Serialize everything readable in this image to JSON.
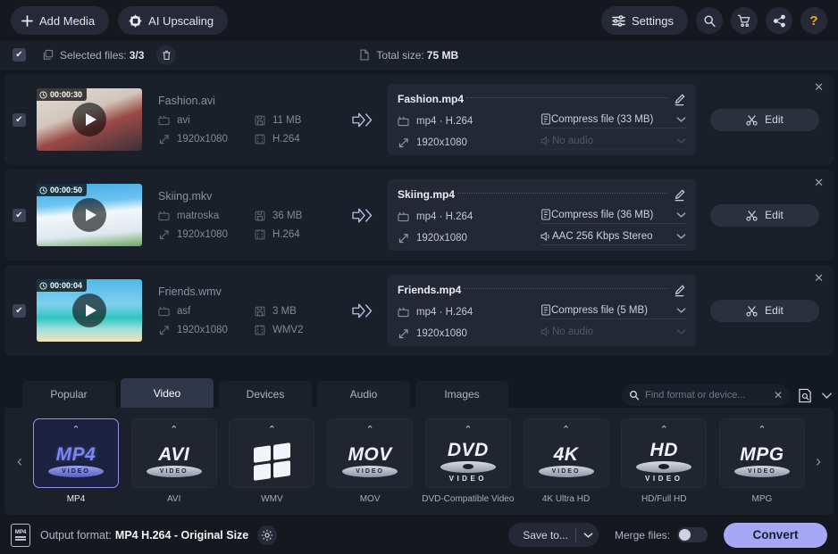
{
  "toolbar": {
    "add_media_label": "Add Media",
    "add_media_icon": "plus-icon",
    "ai_upscaling_label": "AI Upscaling",
    "ai_upscaling_icon": "chip-icon",
    "settings_label": "Settings",
    "settings_icon": "sliders-icon",
    "search_icon": "search-icon",
    "cart_icon": "cart-icon",
    "share_icon": "share-icon",
    "help_icon": "question-mark-icon",
    "help_label": "?",
    "help_color": "#f0a830"
  },
  "selection_bar": {
    "checkbox_icon": "checkmark-icon",
    "checkbox_glyph": "✔",
    "files_icon": "copy-files-icon",
    "selected_label": "Selected files:",
    "selected_count": "3/3",
    "trash_icon": "trash-icon",
    "size_icon": "document-icon",
    "total_size_label": "Total size:",
    "total_size_value": "75 MB"
  },
  "files": [
    {
      "checkbox_glyph": "✔",
      "duration": "00:00:30",
      "clock_icon": "clock-icon",
      "play_icon": "play-icon",
      "thumb_colors": [
        "#d9cfc6",
        "#8a3a3c",
        "#2a2a30"
      ],
      "source_name": "Fashion.avi",
      "container_icon": "film-icon",
      "container": "avi",
      "size_icon": "floppy-icon",
      "size": "11 MB",
      "resolution_icon": "resize-icon",
      "resolution": "1920x1080",
      "codec_icon": "filmstrip-icon",
      "codec": "H.264",
      "convert_arrow_icon": "double-arrow-right-icon",
      "output_name": "Fashion.mp4",
      "edit_name_icon": "pencil-icon",
      "out_format_icon": "film-icon",
      "out_format": "mp4 · H.264",
      "out_resolution_icon": "resize-icon",
      "out_resolution": "1920x1080",
      "compress_icon": "file-size-icon",
      "compress_value": "Compress file (33 MB)",
      "audio_icon": "speaker-icon",
      "audio_value": "No audio",
      "audio_disabled": true,
      "edit_button_label": "Edit",
      "edit_button_icon": "scissors-icon",
      "close_icon": "close-icon",
      "close_glyph": "✕"
    },
    {
      "checkbox_glyph": "✔",
      "duration": "00:00:50",
      "clock_icon": "clock-icon",
      "play_icon": "play-icon",
      "thumb_colors": [
        "#3fa9e8",
        "#eef4f8",
        "#e8d33c"
      ],
      "source_name": "Skiing.mkv",
      "container_icon": "film-icon",
      "container": "matroska",
      "size_icon": "floppy-icon",
      "size": "36 MB",
      "resolution_icon": "resize-icon",
      "resolution": "1920x1080",
      "codec_icon": "filmstrip-icon",
      "codec": "H.264",
      "convert_arrow_icon": "double-arrow-right-icon",
      "output_name": "Skiing.mp4",
      "edit_name_icon": "pencil-icon",
      "out_format_icon": "film-icon",
      "out_format": "mp4 · H.264",
      "out_resolution_icon": "resize-icon",
      "out_resolution": "1920x1080",
      "compress_icon": "file-size-icon",
      "compress_value": "Compress file (36 MB)",
      "audio_icon": "speaker-icon",
      "audio_value": "AAC 256 Kbps Stereo",
      "audio_disabled": false,
      "edit_button_label": "Edit",
      "edit_button_icon": "scissors-icon",
      "close_icon": "close-icon",
      "close_glyph": "✕"
    },
    {
      "checkbox_glyph": "✔",
      "duration": "00:00:04",
      "clock_icon": "clock-icon",
      "play_icon": "play-icon",
      "thumb_colors": [
        "#4fb8e8",
        "#2fc6c0",
        "#f2e2b8"
      ],
      "source_name": "Friends.wmv",
      "container_icon": "film-icon",
      "container": "asf",
      "size_icon": "floppy-icon",
      "size": "3 MB",
      "resolution_icon": "resize-icon",
      "resolution": "1920x1080",
      "codec_icon": "filmstrip-icon",
      "codec": "WMV2",
      "convert_arrow_icon": "double-arrow-right-icon",
      "output_name": "Friends.mp4",
      "edit_name_icon": "pencil-icon",
      "out_format_icon": "film-icon",
      "out_format": "mp4 · H.264",
      "out_resolution_icon": "resize-icon",
      "out_resolution": "1920x1080",
      "compress_icon": "file-size-icon",
      "compress_value": "Compress file (5 MB)",
      "audio_icon": "speaker-icon",
      "audio_value": "No audio",
      "audio_disabled": true,
      "edit_button_label": "Edit",
      "edit_button_icon": "scissors-icon",
      "close_icon": "close-icon",
      "close_glyph": "✕"
    }
  ],
  "tabs": [
    {
      "label": "Popular",
      "active": false
    },
    {
      "label": "Video",
      "active": true
    },
    {
      "label": "Devices",
      "active": false
    },
    {
      "label": "Audio",
      "active": false
    },
    {
      "label": "Images",
      "active": false
    }
  ],
  "search": {
    "icon": "search-icon",
    "placeholder": "Find format or device...",
    "value": "",
    "clear_icon": "close-icon",
    "clear_glyph": "✕",
    "browse_icon": "saved-search-icon",
    "expand_icon": "chevron-down-icon"
  },
  "format_strip": {
    "prev_icon": "chevron-left-icon",
    "prev_glyph": "‹",
    "next_icon": "chevron-right-icon",
    "next_glyph": "›",
    "cards": [
      {
        "id": "mp4",
        "logo_text": "MP4",
        "sub_text": "VIDEO",
        "caption": "MP4",
        "selected": true,
        "style": "ellipse"
      },
      {
        "id": "avi",
        "logo_text": "AVI",
        "sub_text": "VIDEO",
        "caption": "AVI",
        "selected": false,
        "style": "ellipse"
      },
      {
        "id": "wmv",
        "logo_text": "",
        "sub_text": "",
        "caption": "WMV",
        "selected": false,
        "style": "windows"
      },
      {
        "id": "mov",
        "logo_text": "MOV",
        "sub_text": "VIDEO",
        "caption": "MOV",
        "selected": false,
        "style": "ellipse"
      },
      {
        "id": "dvd",
        "logo_text": "DVD",
        "sub_text": "VIDEO",
        "caption": "DVD-Compatible Video",
        "selected": false,
        "style": "disc"
      },
      {
        "id": "4k",
        "logo_text": "4K",
        "sub_text": "VIDEO",
        "caption": "4K Ultra HD",
        "selected": false,
        "style": "ellipse"
      },
      {
        "id": "hd",
        "logo_text": "HD",
        "sub_text": "VIDEO",
        "caption": "HD/Full HD",
        "selected": false,
        "style": "disc"
      },
      {
        "id": "mpg",
        "logo_text": "MPG",
        "sub_text": "VIDEO",
        "caption": "MPG",
        "selected": false,
        "style": "ellipse"
      }
    ],
    "card_expand_icon": "chevron-up-icon"
  },
  "bottom_bar": {
    "format_doc_icon": "mp4-document-icon",
    "format_doc_label": "MP4",
    "output_format_label": "Output format:",
    "output_format_value": "MP4 H.264 - Original Size",
    "gear_icon": "gear-icon",
    "save_to_label": "Save to...",
    "save_to_chevron_icon": "chevron-down-icon",
    "merge_files_label": "Merge files:",
    "merge_toggle_state": "off",
    "convert_label": "Convert",
    "convert_color": "#a5a9f5"
  }
}
